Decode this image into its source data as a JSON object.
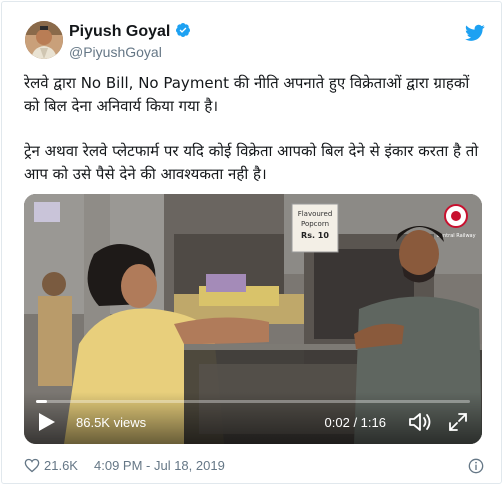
{
  "tweet": {
    "author_name": "Piyush Goyal",
    "author_handle": "@PiyushGoyal",
    "verified": true,
    "paragraphs": [
      "रेलवे द्वारा No Bill, No Payment की नीति अपनाते हुए विक्रेताओं द्वारा ग्राहकों को बिल देना अनिवार्य किया गया है।",
      "ट्रेन अथवा रेलवे प्लेटफार्म पर यदि कोई विक्रेता आपको बिल देने से इंकार करता है तो आप को उसे पैसे देने की आवश्यकता नही है।"
    ],
    "likes": "21.6K",
    "timestamp": "4:09 PM - Jul 18, 2019"
  },
  "video": {
    "views": "86.5K views",
    "time": "0:02 / 1:16",
    "progress_fraction": 0.026,
    "sign_text_1": "Flavoured",
    "sign_text_2": "Popcorn",
    "sign_text_3": "Rs. 10",
    "logo_caption": "Central Railway"
  },
  "colors": {
    "twitter_blue": "#1da1f2",
    "text": "#14171a",
    "muted": "#657786",
    "border": "#e1e8ed"
  },
  "icons": [
    "verified-badge-icon",
    "twitter-logo-icon",
    "play-icon",
    "volume-icon",
    "fullscreen-icon",
    "heart-icon",
    "info-icon"
  ]
}
